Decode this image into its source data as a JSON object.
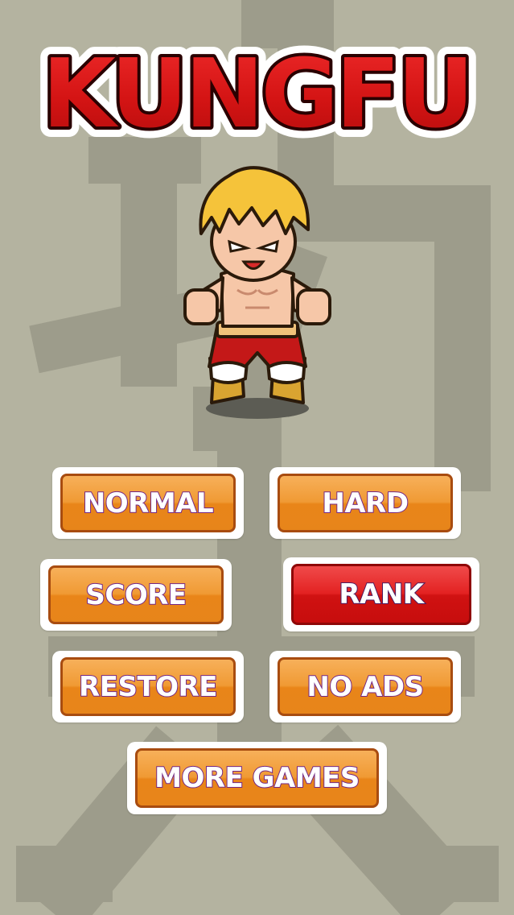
{
  "title": "KUNGFU",
  "background_glyph": "功夫",
  "buttons": {
    "normal": "NORMAL",
    "hard": "HARD",
    "score": "SCORE",
    "rank": "RANK",
    "restore": "RESTORE",
    "no_ads": "NO ADS",
    "more_games": "MORE GAMES"
  },
  "colors": {
    "background": "#b4b3a0",
    "glyph": "#9d9c8b",
    "title_red": "#d41414",
    "button_orange": "#ef9a30",
    "button_red": "#dd1c1c",
    "label_outline": "#7a2a8a"
  }
}
